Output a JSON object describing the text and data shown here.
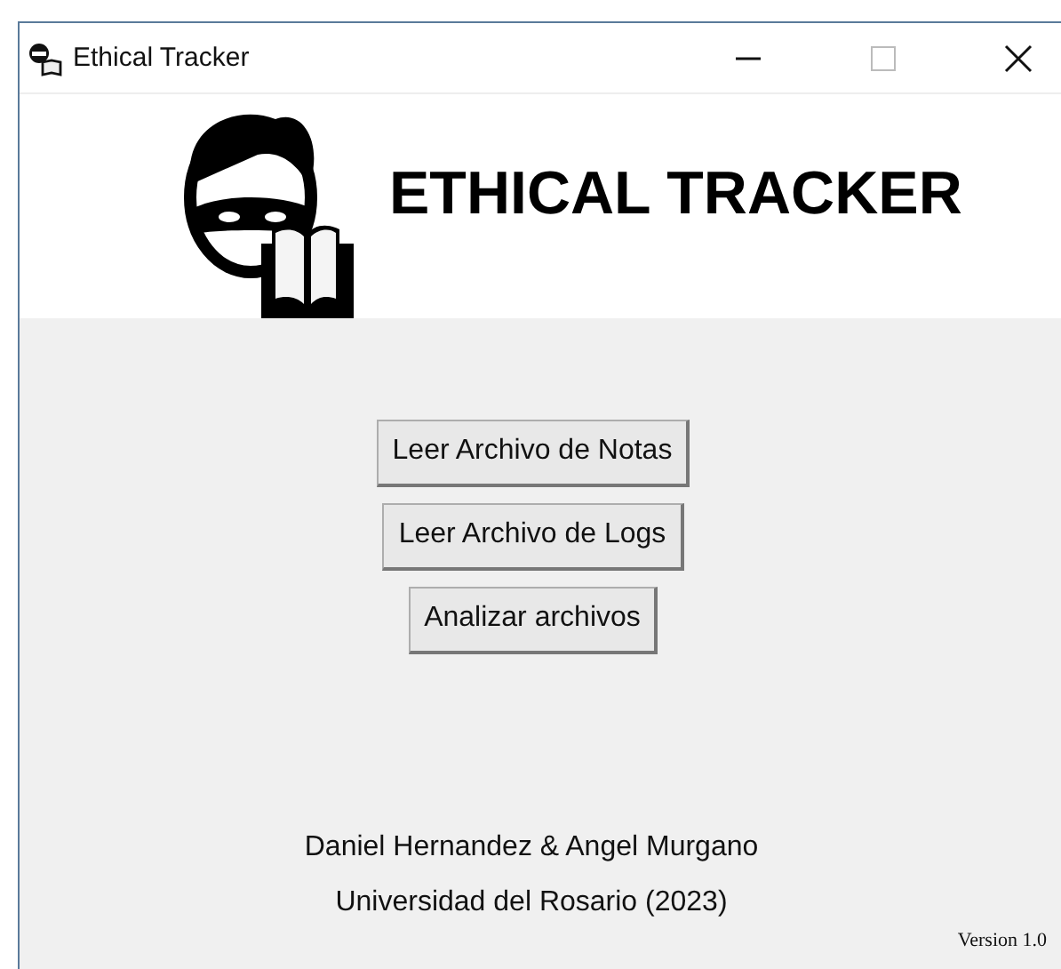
{
  "window": {
    "title": "Ethical Tracker"
  },
  "banner": {
    "title": "ETHICAL TRACKER"
  },
  "buttons": [
    "Leer Archivo de Notas",
    "Leer Archivo de Logs",
    "Analizar archivos"
  ],
  "credits": [
    "Daniel Hernandez & Angel Murgano",
    "Universidad del Rosario (2023)"
  ],
  "version": "Version 1.0"
}
